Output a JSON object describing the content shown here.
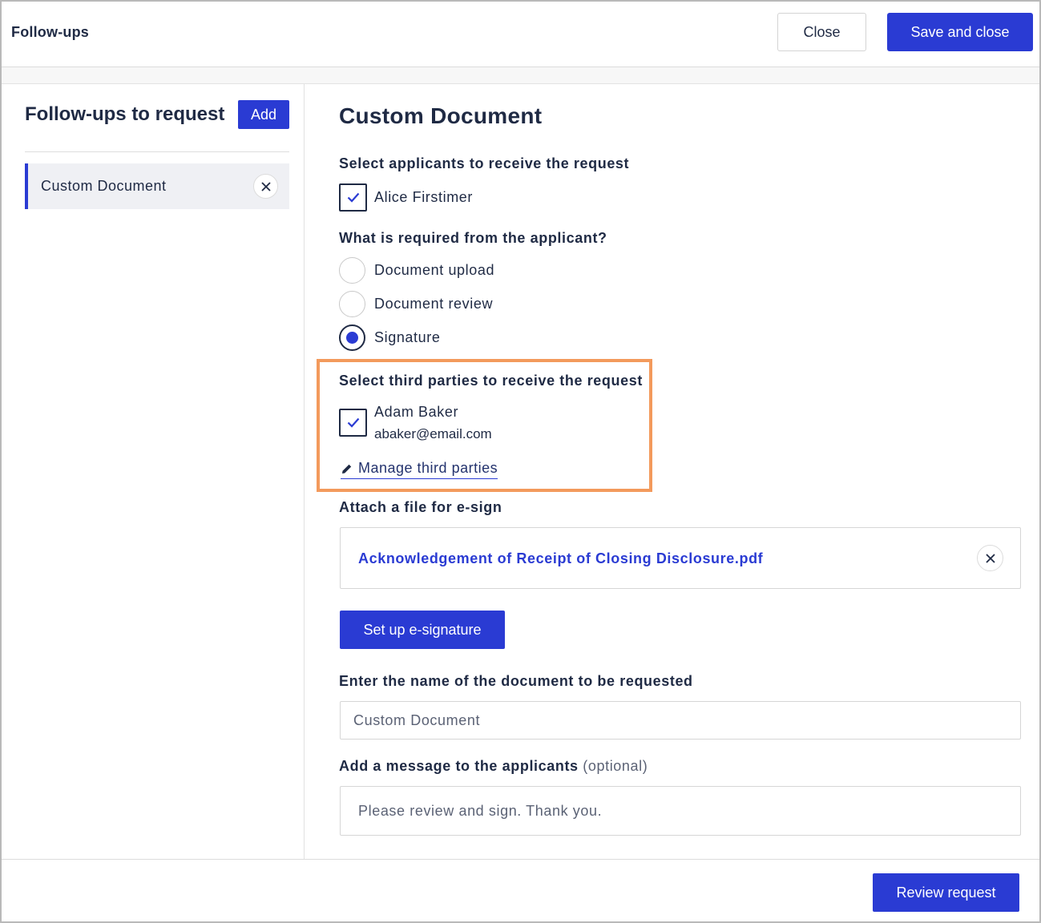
{
  "header": {
    "title": "Follow-ups",
    "close_label": "Close",
    "save_label": "Save and close"
  },
  "sidebar": {
    "title": "Follow-ups to request",
    "add_label": "Add",
    "items": [
      {
        "label": "Custom Document"
      }
    ]
  },
  "main": {
    "title": "Custom Document",
    "applicants_label": "Select applicants to receive the request",
    "applicants": [
      {
        "name": "Alice Firstimer",
        "checked": true
      }
    ],
    "required_label": "What is required from the applicant?",
    "required_options": [
      {
        "label": "Document upload",
        "selected": false
      },
      {
        "label": "Document review",
        "selected": false
      },
      {
        "label": "Signature",
        "selected": true
      }
    ],
    "third_parties_label": "Select third parties to receive the request",
    "third_parties": [
      {
        "name": "Adam Baker",
        "email": "abaker@email.com",
        "checked": true
      }
    ],
    "manage_label": "Manage third parties",
    "attach_label": "Attach a file for e-sign",
    "attached_file": "Acknowledgement of Receipt of Closing Disclosure.pdf",
    "esign_label": "Set up e-signature",
    "doc_name_label": "Enter the name of the document to be requested",
    "doc_name_value": "Custom Document",
    "message_label": "Add a message to the applicants",
    "message_optional": "(optional)",
    "message_value": "Please review and sign. Thank you."
  },
  "footer": {
    "review_label": "Review request"
  },
  "colors": {
    "accent": "#2a3bd3",
    "text": "#1f2a44",
    "highlight": "#f39a5c"
  }
}
